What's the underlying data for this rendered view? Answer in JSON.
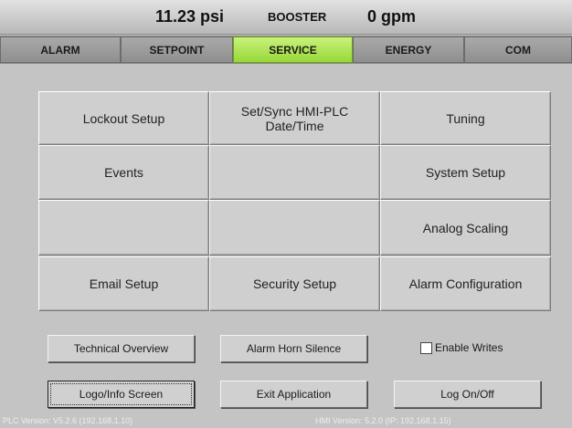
{
  "status": {
    "pressure": "11.23 psi",
    "mode": "BOOSTER",
    "flow": "0 gpm"
  },
  "tabs": [
    {
      "label": "ALARM",
      "active": false
    },
    {
      "label": "SETPOINT",
      "active": false
    },
    {
      "label": "SERVICE",
      "active": true
    },
    {
      "label": "ENERGY",
      "active": false
    },
    {
      "label": "COM",
      "active": false
    }
  ],
  "grid": {
    "lockout_setup": "Lockout Setup",
    "set_sync_time": "Set/Sync HMI-PLC Date/Time",
    "tuning": "Tuning",
    "events": "Events",
    "system_setup": "System Setup",
    "analog_scaling": "Analog Scaling",
    "email_setup": "Email Setup",
    "security_setup": "Security Setup",
    "alarm_configuration": "Alarm Configuration"
  },
  "buttons": {
    "technical_overview": "Technical Overview",
    "alarm_horn_silence": "Alarm Horn Silence",
    "enable_writes": "Enable Writes",
    "logo_info_screen": "Logo/Info Screen",
    "exit_application": "Exit Application",
    "log_on_off": "Log On/Off"
  },
  "enable_writes_checked": false,
  "footer": {
    "plc_version": "PLC Version: V5.2.6   (192.168.1.10)",
    "hmi_version": "HMI Version: 5.2.0 (IP: 192.168.1.15)"
  }
}
